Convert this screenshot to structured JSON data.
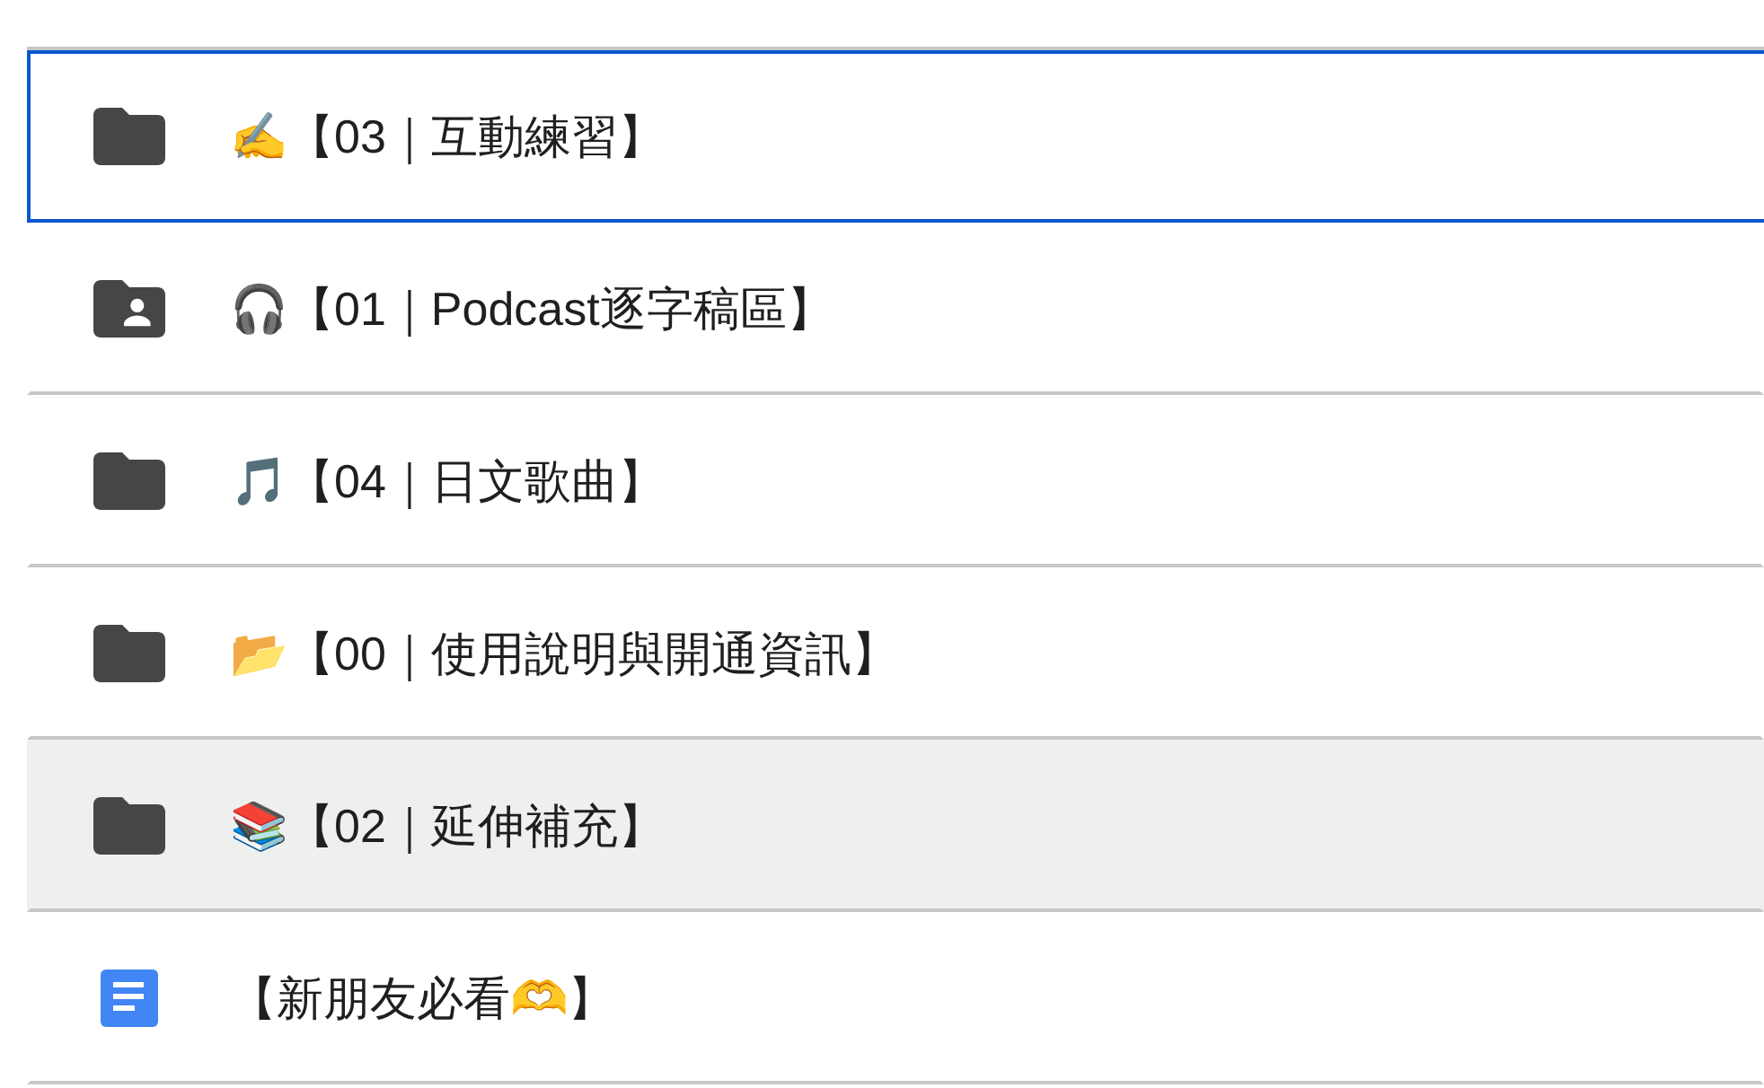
{
  "file_list": {
    "items": [
      {
        "kind": "folder",
        "name": "✍️【03｜互動練習】",
        "selected": true,
        "hovered": false
      },
      {
        "kind": "shared",
        "name": "🎧【01｜Podcast逐字稿區】",
        "selected": false,
        "hovered": false
      },
      {
        "kind": "folder",
        "name": "🎵【04｜日文歌曲】",
        "selected": false,
        "hovered": false
      },
      {
        "kind": "folder",
        "name": "📂【00｜使用說明與開通資訊】",
        "selected": false,
        "hovered": false
      },
      {
        "kind": "folder",
        "name": "📚【02｜延伸補充】",
        "selected": false,
        "hovered": true
      },
      {
        "kind": "document",
        "name": "【新朋友必看🫶】",
        "selected": false,
        "hovered": false
      }
    ]
  }
}
